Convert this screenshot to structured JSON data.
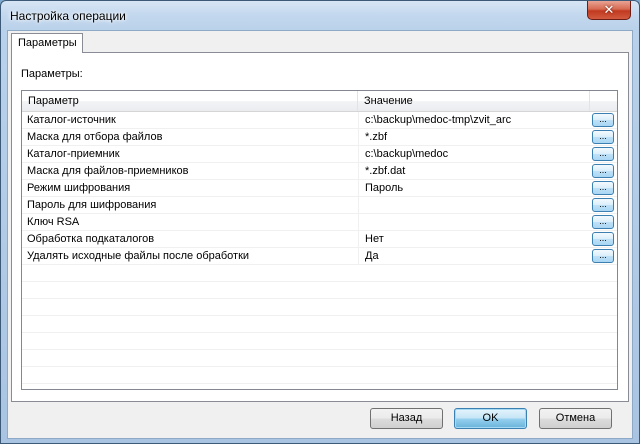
{
  "window": {
    "title": "Настройка операции",
    "close_glyph": "✕"
  },
  "tabs": [
    {
      "label": "Параметры",
      "active": true
    }
  ],
  "panel": {
    "caption": "Параметры:"
  },
  "grid": {
    "columns": [
      "Параметр",
      "Значение",
      ""
    ],
    "rows": [
      {
        "name": "Каталог-источник",
        "value": "c:\\backup\\medoc-tmp\\zvit_arc",
        "button": "..."
      },
      {
        "name": "Маска для отбора файлов",
        "value": "*.zbf",
        "button": "..."
      },
      {
        "name": "Каталог-приемник",
        "value": "c:\\backup\\medoc",
        "button": "..."
      },
      {
        "name": "Маска для файлов-приемников",
        "value": "*.zbf.dat",
        "button": "..."
      },
      {
        "name": "Режим шифрования",
        "value": "Пароль",
        "button": "..."
      },
      {
        "name": "Пароль для шифрования",
        "value": "",
        "button": "..."
      },
      {
        "name": "Ключ RSA",
        "value": "",
        "button": "..."
      },
      {
        "name": "Обработка подкаталогов",
        "value": "Нет",
        "button": "..."
      },
      {
        "name": "Удалять исходные файлы после обработки",
        "value": "Да",
        "button": "..."
      }
    ]
  },
  "buttons": {
    "back": "Назад",
    "ok": "OK",
    "cancel": "Отмена"
  },
  "icons": {
    "close": "close-icon",
    "row_button": "ellipsis-icon"
  }
}
